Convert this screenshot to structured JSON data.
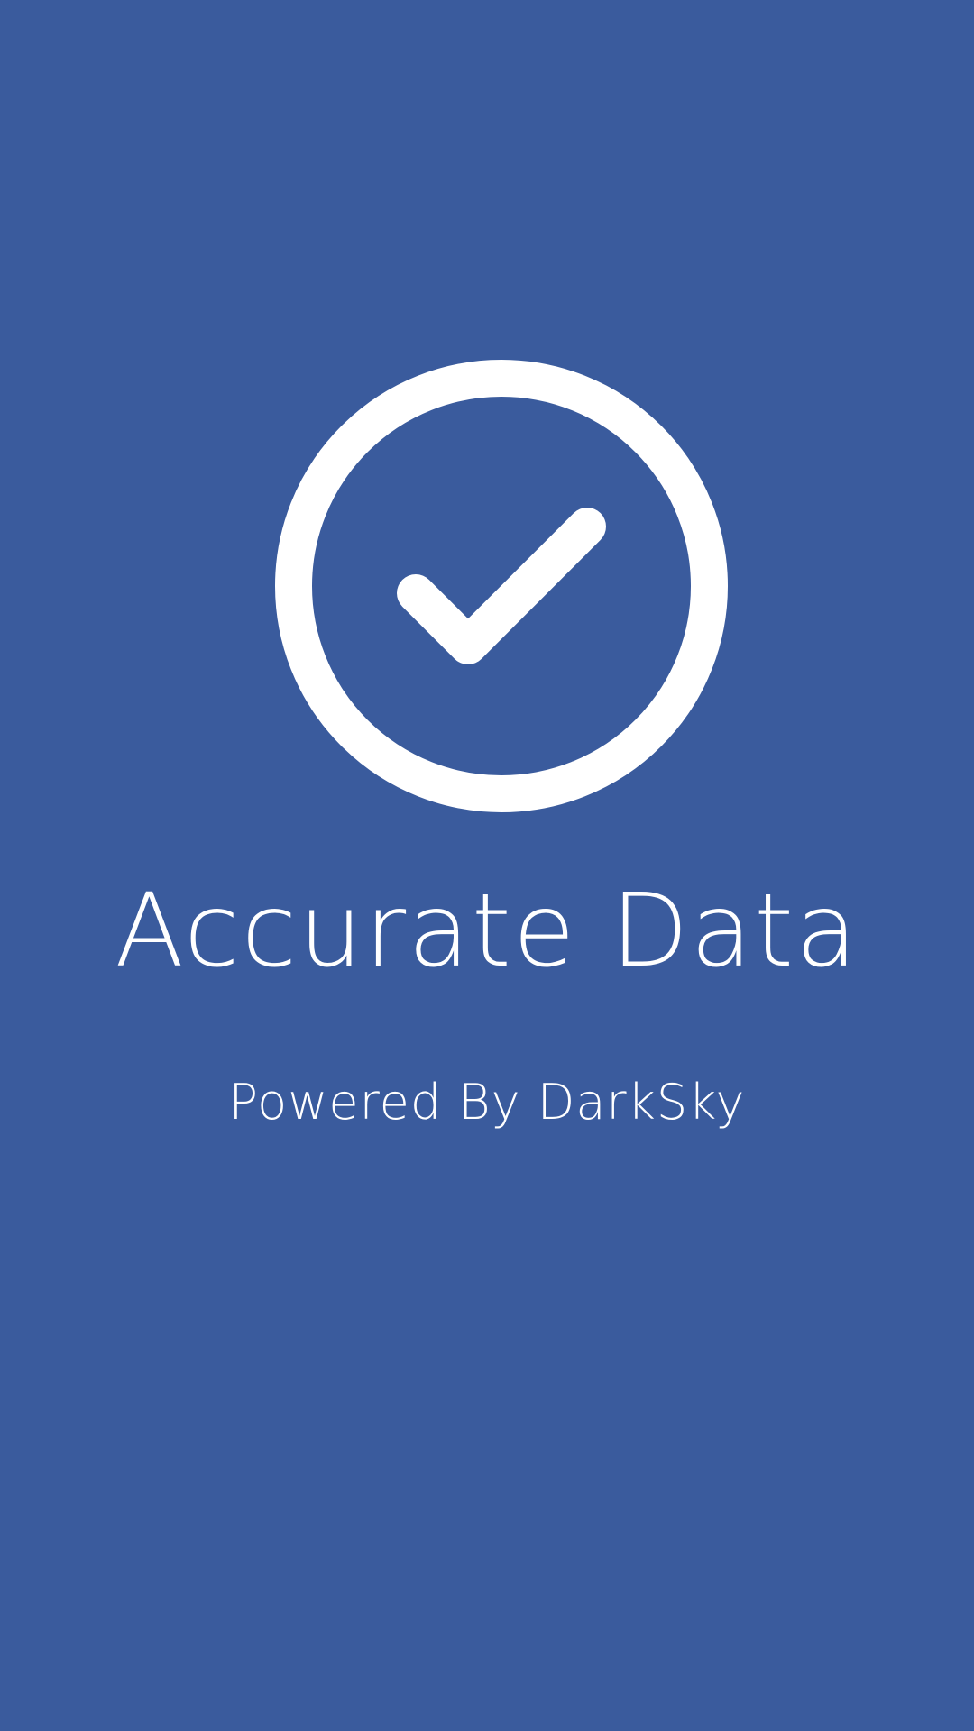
{
  "screen": {
    "background_color": "#3a5b9d",
    "foreground_color": "#ffffff"
  },
  "hero": {
    "icon": "check-circle-icon"
  },
  "title": "Accurate Data",
  "subtitle": "Powered By DarkSky"
}
